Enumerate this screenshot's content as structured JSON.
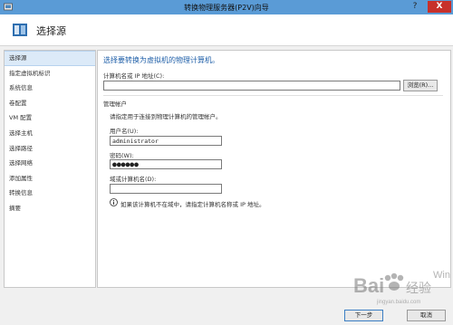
{
  "window": {
    "title": "转换物理服务器(P2V)向导",
    "help_label": "?",
    "close_label": "X"
  },
  "header": {
    "title": "选择源"
  },
  "sidebar": {
    "items": [
      {
        "label": "选择源"
      },
      {
        "label": "指定虚拟机标识"
      },
      {
        "label": "系统信息"
      },
      {
        "label": "卷配置"
      },
      {
        "label": "VM 配置"
      },
      {
        "label": "选择主机"
      },
      {
        "label": "选择路径"
      },
      {
        "label": "选择网络"
      },
      {
        "label": "添加属性"
      },
      {
        "label": "转换信息"
      },
      {
        "label": "摘要"
      }
    ]
  },
  "main": {
    "heading": "选择要转换为虚拟机的物理计算机。",
    "computer_label": "计算机名或 IP 地址(C):",
    "computer_value": "",
    "browse_label": "浏览(R)...",
    "admin_section": "管理帐户",
    "admin_desc": "请指定用于连接到物理计算机的管理帐户。",
    "username_label": "用户名(U):",
    "username_value": "administrator",
    "password_label": "密码(W):",
    "password_mask": "●●●●●●",
    "domain_label": "域或计算机名(D):",
    "domain_value": "",
    "info_text": "如果该计算机不在域中，请指定计算机名称或 IP 地址。"
  },
  "footer": {
    "next_label": "下一步",
    "cancel_label": "取消"
  },
  "watermark": {
    "brand": "Bai",
    "brand_suffix": "经验",
    "sub": "jingyan.baidu.com",
    "win": "Win"
  },
  "colors": {
    "titlebar": "#5a9bd6",
    "heading": "#1f5fa8",
    "selected": "#dceaf8",
    "close": "#c7302b"
  }
}
